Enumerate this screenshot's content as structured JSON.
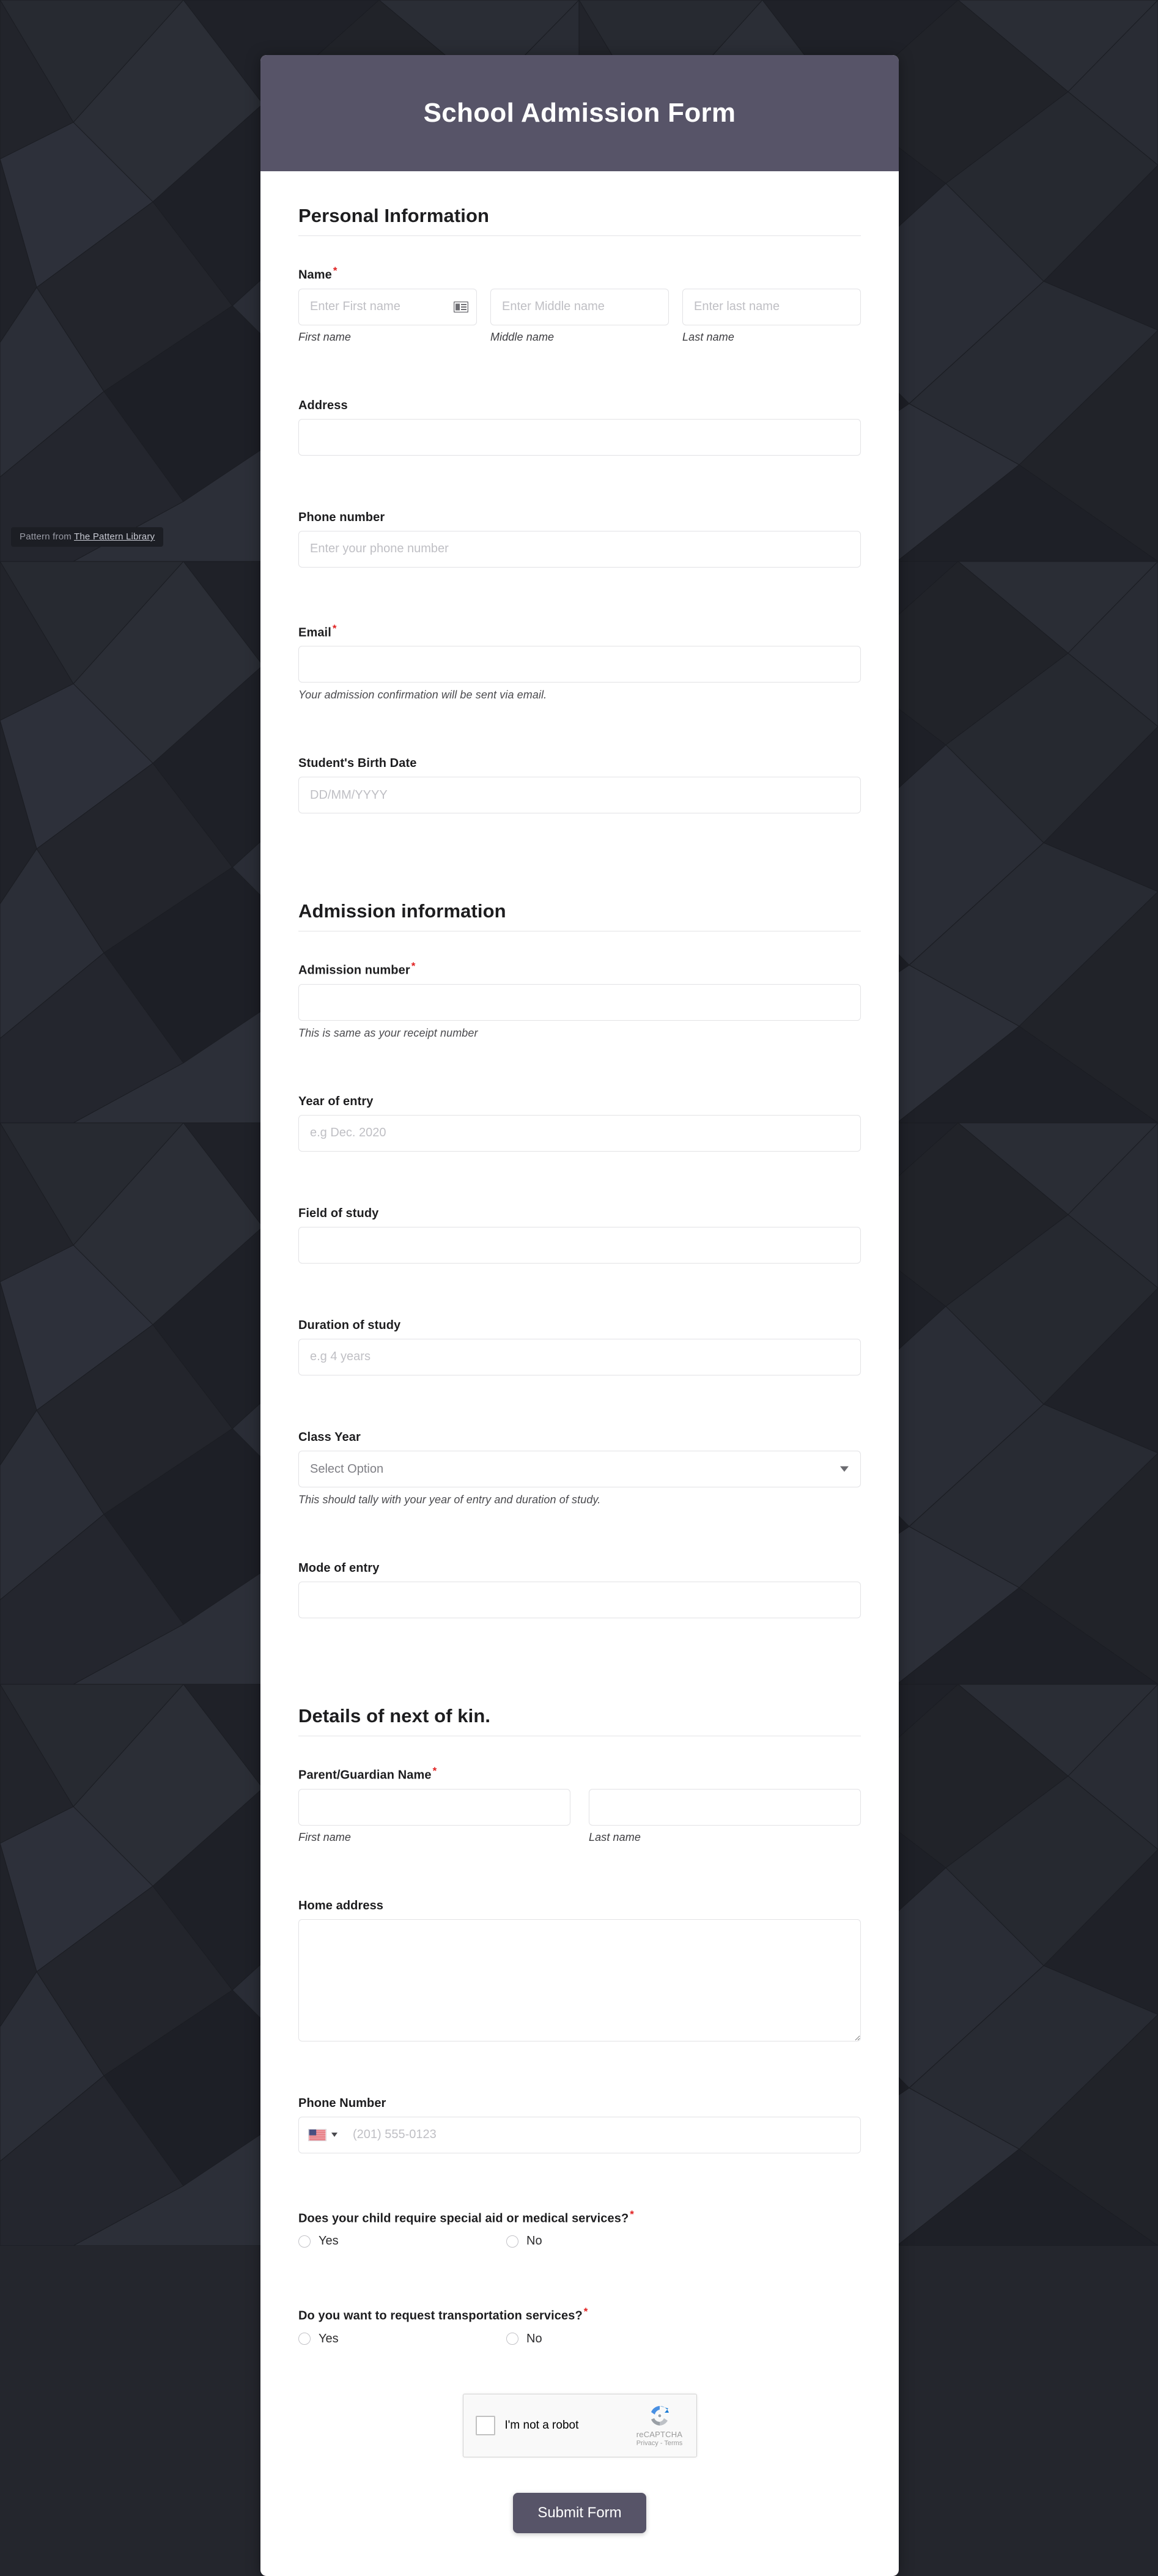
{
  "background": {
    "credit_prefix": "Pattern from ",
    "credit_link": "The Pattern Library",
    "base_color": "#24262d"
  },
  "header": {
    "title": "School Admission Form",
    "background_color": "#575468",
    "text_color": "#ffffff"
  },
  "sections": {
    "personal": {
      "title": "Personal Information"
    },
    "admission": {
      "title": "Admission information"
    },
    "kin": {
      "title": "Details of next of kin."
    }
  },
  "fields": {
    "name": {
      "label": "Name",
      "required_marker": "*",
      "first": {
        "placeholder": "Enter First name",
        "sublabel": "First name",
        "value": ""
      },
      "middle": {
        "placeholder": "Enter Middle name",
        "sublabel": "Middle name",
        "value": ""
      },
      "last": {
        "placeholder": "Enter last name",
        "sublabel": "Last name",
        "value": ""
      }
    },
    "address": {
      "label": "Address",
      "placeholder": "",
      "value": ""
    },
    "phone_number": {
      "label": "Phone number",
      "placeholder": "Enter your phone number",
      "value": ""
    },
    "email": {
      "label": "Email",
      "required_marker": "*",
      "placeholder": "",
      "value": "",
      "hint": "Your admission confirmation will be sent via email."
    },
    "birth_date": {
      "label": "Student's Birth Date",
      "placeholder": "DD/MM/YYYY",
      "value": ""
    },
    "admission_number": {
      "label": "Admission number",
      "required_marker": "*",
      "placeholder": "",
      "value": "",
      "hint": "This is same as your receipt number"
    },
    "year_of_entry": {
      "label": "Year of entry",
      "placeholder": "e.g Dec. 2020",
      "value": ""
    },
    "field_of_study": {
      "label": "Field of study",
      "placeholder": "",
      "value": ""
    },
    "duration_of_study": {
      "label": "Duration of study",
      "placeholder": "e.g 4 years",
      "value": ""
    },
    "class_year": {
      "label": "Class Year",
      "selected": "Select Option",
      "options": [
        "Select Option"
      ],
      "hint": "This should tally with your year of entry and duration of study."
    },
    "mode_of_entry": {
      "label": "Mode of entry",
      "placeholder": "",
      "value": ""
    },
    "guardian_name": {
      "label": "Parent/Guardian Name",
      "required_marker": "*",
      "first": {
        "placeholder": "",
        "sublabel": "First name",
        "value": ""
      },
      "last": {
        "placeholder": "",
        "sublabel": "Last name",
        "value": ""
      }
    },
    "home_address": {
      "label": "Home address",
      "placeholder": "",
      "value": ""
    },
    "kin_phone": {
      "label": "Phone Number",
      "placeholder": "(201) 555-0123",
      "value": "",
      "country_flag": "us-flag-icon"
    }
  },
  "questions": {
    "special_aid": {
      "label": "Does your child require special aid or medical services?",
      "required_marker": "*",
      "options": [
        "Yes",
        "No"
      ],
      "selected": null
    },
    "transportation": {
      "label": "Do you want to request transportation services?",
      "required_marker": "*",
      "options": [
        "Yes",
        "No"
      ],
      "selected": null
    }
  },
  "captcha": {
    "checkbox_label": "I'm not a robot",
    "brand": "reCAPTCHA",
    "privacy": "Privacy",
    "separator": "-",
    "terms": "Terms",
    "checked": false
  },
  "submit": {
    "label": "Submit Form",
    "color": "#575468"
  }
}
